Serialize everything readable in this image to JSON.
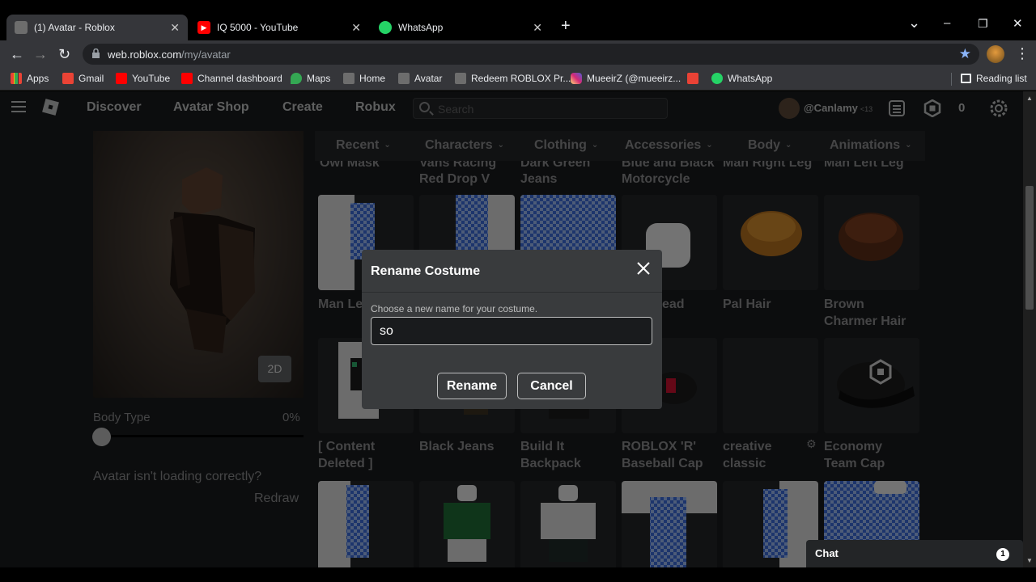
{
  "browser": {
    "tabs": [
      {
        "title": "(1) Avatar - Roblox",
        "active": true
      },
      {
        "title": "IQ 5000 - YouTube",
        "active": false
      },
      {
        "title": "WhatsApp",
        "active": false
      }
    ],
    "new_tab": "+",
    "url_host": "web.roblox.com",
    "url_path": "/my/avatar",
    "bookmarks": [
      "Apps",
      "Gmail",
      "YouTube",
      "Channel dashboard",
      "Maps",
      "Home",
      "Avatar",
      "Redeem ROBLOX Pr...",
      "MueeirZ (@mueeirz...",
      "WhatsApp"
    ],
    "reading_list": "Reading list",
    "window_controls": {
      "minimize": "–",
      "restore": "❐",
      "close": "✕",
      "tab_search": "⌄"
    },
    "nav": {
      "back": "←",
      "forward": "→",
      "reload": "↻",
      "menu": "⋮",
      "star": "★"
    }
  },
  "roblox_nav": {
    "links": [
      "Discover",
      "Avatar Shop",
      "Create",
      "Robux"
    ],
    "search_placeholder": "Search",
    "username": "@Canlamy",
    "age_label": "<13",
    "robux_count": "0"
  },
  "avatar_panel": {
    "button_2d": "2D",
    "body_type_label": "Body Type",
    "body_type_value": "0%",
    "body_type_fraction": 0,
    "loading_question": "Avatar isn't loading correctly?",
    "redraw": "Redraw"
  },
  "categories": [
    "Recent",
    "Characters",
    "Clothing",
    "Accessories",
    "Body",
    "Animations"
  ],
  "partial_row": [
    {
      "line1": "Owl Mask",
      "line2": ""
    },
    {
      "line1": "Vans Racing",
      "line2": "Red Drop V"
    },
    {
      "line1": "Dark Green",
      "line2": "Jeans"
    },
    {
      "line1": "Blue and Black",
      "line2": "Motorcycle"
    },
    {
      "line1": "Man Right Leg",
      "line2": ""
    },
    {
      "line1": "Man Left Leg",
      "line2": ""
    }
  ],
  "row1_names": [
    {
      "line1": "Man Le",
      "line2": ""
    },
    {
      "line1": "",
      "line2": ""
    },
    {
      "line1": "",
      "line2": ""
    },
    {
      "line1": "ead",
      "line2": ""
    },
    {
      "line1": "Pal Hair",
      "line2": ""
    },
    {
      "line1": "Brown",
      "line2": "Charmer Hair"
    }
  ],
  "row2_names": [
    {
      "line1": "[ Content",
      "line2": "Deleted ]"
    },
    {
      "line1": "Black Jeans",
      "line2": ""
    },
    {
      "line1": "Build It",
      "line2": "Backpack"
    },
    {
      "line1": "ROBLOX 'R'",
      "line2": "Baseball Cap"
    },
    {
      "line1": "creative",
      "line2": "classic"
    },
    {
      "line1": "Economy",
      "line2": "Team Cap"
    }
  ],
  "modal": {
    "title": "Rename Costume",
    "prompt": "Choose a new name for your costume.",
    "input_value": "so",
    "rename_button": "Rename",
    "cancel_button": "Cancel"
  },
  "chat": {
    "label": "Chat",
    "badge": "1"
  },
  "colors": {
    "page_bg": "#191b1d",
    "tile_bg": "#232527",
    "modal_bg": "#393b3d",
    "text_muted": "#8a8b8c"
  }
}
